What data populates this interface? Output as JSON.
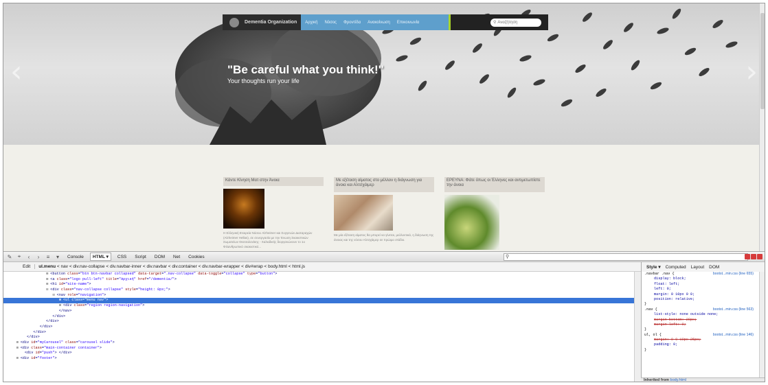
{
  "navbar": {
    "brand": "Dementia Organization",
    "links": [
      "Αρχική",
      "Νόσος",
      "Φροντίδα",
      "Ανακοίνωση",
      "Επικοινωνία"
    ],
    "search_placeholder": "Αναζήτηση"
  },
  "carousel": {
    "title": "\"Be careful what you think!\"",
    "subtitle": "Your thoughts run your life",
    "prev_arrow": "‹",
    "next_arrow": "›"
  },
  "cards": [
    {
      "title": "Κάντε Κίνηση Ματ στην Άνοια",
      "text": "Η Ελληνική Εταιρεία Νόσου Alzheimer και Συγγενών Διαταραχών (Alzheimer Hellas), σε συνεργασία με την Ένωση Σκακιστικών Σωματείων Θεσσαλονίκης - Χαλκιδικής διοργανώνουν το 1ο Φιλανθρωπικό σκακιστικό..."
    },
    {
      "title": "Με εξέταση αίματος στο μέλλον η διάγνωση για άνοια και Αλτσχάιμερ",
      "text": "Με μία εξέταση αίματος θα μπορεί να γίνεται, μελλοντικά, η διάγνωση της άνοιας και της νόσου Αλτσχάιμερ σε πρώιμο στάδιο."
    },
    {
      "title": "ΕΡΕΥΝΑ: Φάτε όπως οι Έλληνες και αντιμετωπίστε την άνοια",
      "text": ""
    }
  ],
  "firebug": {
    "toolbar_tabs": [
      "Console",
      "HTML ▾",
      "CSS",
      "Script",
      "DOM",
      "Net",
      "Cookies"
    ],
    "active_tab": "HTML ▾",
    "search_icon": "search-icon",
    "breadcrumb_edit": "Edit",
    "breadcrumb_current": "ul.menu",
    "breadcrumb_trail": " < nav < div.nav-collapse < div.navbar-inner < div.navbar < div.container < div.navbar-wrapper < div#wrap < body.html < html.js",
    "side_tabs": [
      "Style ▾",
      "Computed",
      "Layout",
      "DOM"
    ],
    "inherited_label": "Inherited from",
    "inherited_from": "body.html"
  },
  "html_lines": [
    {
      "indent": 20,
      "tw": "⊞",
      "text": "<button class=\"btn btn-navbar collapsed\" data-target=\".nav-collapse\" data-toggle=\"collapse\" type=\"button\">"
    },
    {
      "indent": 20,
      "tw": "⊞",
      "text": "<a class=\"logo pull-left\" title=\"Αρχική\" href=\"/dementia/\">"
    },
    {
      "indent": 20,
      "tw": "⊞",
      "text": "<h1 id=\"site-name\">"
    },
    {
      "indent": 20,
      "tw": "⊟",
      "text": "<div class=\"nav-collapse collapse\" style=\"height: 0px;\">"
    },
    {
      "indent": 23,
      "tw": "⊟",
      "text": "<nav role=\"navigation\">"
    },
    {
      "indent": 26,
      "tw": "⊞",
      "text": "<ul class=\"menu nav\">",
      "selected": true
    },
    {
      "indent": 26,
      "tw": "⊞",
      "text": "<div class=\"region region-navigation\">"
    },
    {
      "indent": 24,
      "tw": "",
      "text": "</nav>"
    },
    {
      "indent": 21,
      "tw": "",
      "text": "</div>"
    },
    {
      "indent": 18,
      "tw": "",
      "text": "</div>"
    },
    {
      "indent": 15,
      "tw": "",
      "text": "</div>"
    },
    {
      "indent": 12,
      "tw": "",
      "text": "</div>"
    },
    {
      "indent": 9,
      "tw": "",
      "text": "</div>"
    },
    {
      "indent": 6,
      "tw": "⊞",
      "text": "<div id=\"myCarousel\" class=\"carousel slide\">"
    },
    {
      "indent": 6,
      "tw": "⊞",
      "text": "<div class=\"main-container container\">"
    },
    {
      "indent": 8,
      "tw": "",
      "text": "<div id=\"push\"> </div>"
    },
    {
      "indent": 6,
      "tw": "⊞",
      "text": "<div id=\"footer\">"
    }
  ],
  "style_rules": [
    {
      "kind": "sel",
      "text": ".navbar .nav {",
      "src": "bootst...min.css (line 655)"
    },
    {
      "kind": "prop",
      "text": "display: block;"
    },
    {
      "kind": "prop",
      "text": "float: left;"
    },
    {
      "kind": "prop",
      "text": "left: 0;"
    },
    {
      "kind": "prop",
      "text": "margin: 0 10px 0 0;"
    },
    {
      "kind": "prop",
      "text": "position: relative;"
    },
    {
      "kind": "close",
      "text": "}"
    },
    {
      "kind": "sel",
      "text": ".nav {",
      "src": "bootst...min.css (line 563)"
    },
    {
      "kind": "prop",
      "text": "list-style: none outside none;"
    },
    {
      "kind": "over",
      "text": "margin-bottom: 20px;"
    },
    {
      "kind": "over",
      "text": "margin-left: 0;"
    },
    {
      "kind": "close",
      "text": "}"
    },
    {
      "kind": "sel",
      "text": "ul, ol {",
      "src": "bootst...min.css (line 146)"
    },
    {
      "kind": "over",
      "text": "margin: 0 0 10px 25px;"
    },
    {
      "kind": "prop",
      "text": "padding: 0;"
    },
    {
      "kind": "close",
      "text": "}"
    }
  ],
  "colors": {
    "navbar_bg": "#222222",
    "nav_links_bg": "#5e9fcc",
    "nav_accent": "#a8d42b",
    "selected_row": "#3875d7"
  }
}
